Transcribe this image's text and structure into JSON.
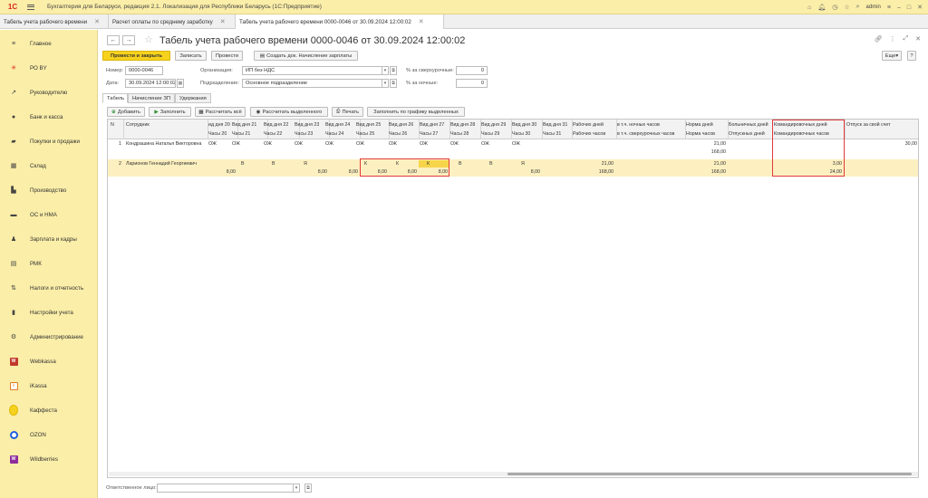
{
  "app": {
    "title": "Бухгалтерия для Беларуси, редакция 2.1. Локализация для Республики Беларусь  (1С:Предприятие)",
    "logo": "1С",
    "user": "admin",
    "colors": {
      "accent": "#f7d21d",
      "sidebar": "#fbeea8",
      "highlight": "#e03a3a"
    }
  },
  "tabs": [
    {
      "label": "Табель учета рабочего времени"
    },
    {
      "label": "Расчет оплаты по среднему заработку"
    },
    {
      "label": "Табель учета рабочего времени 0000-0046 от 30.09.2024 12:00:02"
    }
  ],
  "sidebar": {
    "items": [
      {
        "label": "Главное",
        "icon": "menu-icon"
      },
      {
        "label": "РО BY",
        "icon": "star-icon"
      },
      {
        "label": "Руководителю",
        "icon": "trend-icon"
      },
      {
        "label": "Банк и касса",
        "icon": "coin-icon"
      },
      {
        "label": "Покупки и продажи",
        "icon": "cart-icon"
      },
      {
        "label": "Склад",
        "icon": "warehouse-icon"
      },
      {
        "label": "Производство",
        "icon": "factory-icon"
      },
      {
        "label": "ОС и НМА",
        "icon": "truck-icon"
      },
      {
        "label": "Зарплата и кадры",
        "icon": "person-icon"
      },
      {
        "label": "РМК",
        "icon": "register-icon"
      },
      {
        "label": "Налоги и отчетность",
        "icon": "taxes-icon"
      },
      {
        "label": "Настройки учета",
        "icon": "book-icon"
      },
      {
        "label": "Администрирование",
        "icon": "gear-icon"
      },
      {
        "label": "Webkassa",
        "icon": "webkassa-icon"
      },
      {
        "label": "iKassa",
        "icon": "ikassa-icon"
      },
      {
        "label": "Каффеста",
        "icon": "kaffesta-icon"
      },
      {
        "label": "OZON",
        "icon": "ozon-icon"
      },
      {
        "label": "Wildberries",
        "icon": "wildberries-icon"
      }
    ]
  },
  "doc": {
    "title": "Табель учета рабочего времени 0000-0046 от 30.09.2024 12:00:02",
    "toolbar": {
      "post_close": "Провести и закрыть",
      "save": "Записать",
      "post": "Провести",
      "create_based": "Создать док. Начисление зарплаты",
      "more": "Еще",
      "help": "?"
    },
    "fields": {
      "number_label": "Номер:",
      "number": "0000-0046",
      "date_label": "Дата:",
      "date": "30.09.2024 12:00:02",
      "org_label": "Организация:",
      "org": "ИП без НДС",
      "dept_label": "Подразделение:",
      "dept": "Основное подразделение",
      "overtime_label": "% за сверхурочные:",
      "overtime": "0",
      "night_label": "% за ночные:",
      "night": "0"
    },
    "subtabs": [
      "Табель",
      "Начисление ЗП",
      "Удержания"
    ],
    "gridbar": {
      "add": "Добавить",
      "fill": "Заполнить",
      "calc_all": "Рассчитать всё",
      "calc_selected": "Рассчитать выделенного",
      "print": "Печать",
      "fill_schedule": "Заполнить по графику выделенных"
    },
    "table": {
      "headers": {
        "n": "N",
        "employee": "Сотрудник",
        "days": [
          {
            "top": "ид дня 20",
            "bottom": "Часы 20"
          },
          {
            "top": "Вид дня 21",
            "bottom": "Часы 21"
          },
          {
            "top": "Вид дня 22",
            "bottom": "Часы 22"
          },
          {
            "top": "Вид дня 23",
            "bottom": "Часы 23"
          },
          {
            "top": "Вид дня 24",
            "bottom": "Часы 24"
          },
          {
            "top": "Вид дня 25",
            "bottom": "Часы 25"
          },
          {
            "top": "Вид дня 26",
            "bottom": "Часы 26"
          },
          {
            "top": "Вид дня 27",
            "bottom": "Часы 27"
          },
          {
            "top": "Вид дня 28",
            "bottom": "Часы 28"
          },
          {
            "top": "Вид дня 29",
            "bottom": "Часы 29"
          },
          {
            "top": "Вид дня 30",
            "bottom": "Часы 30"
          },
          {
            "top": "Вид дня 31",
            "bottom": "Часы 31"
          }
        ],
        "work_days": "Рабочих дней",
        "work_hours": "Рабочих часов",
        "night": "в т.ч. ночных часов",
        "overtime": "в т.ч. сверхурочных часов",
        "norm_days": "Норма дней",
        "norm_hours": "Норма часов",
        "sick": "Больничных дней",
        "vacation": "Отпускных дней",
        "trip_days": "Командировочных дней",
        "trip_hours": "Командировочных часов",
        "leave": "Отпуск за свой счет"
      },
      "rows": [
        {
          "n": "1",
          "employee": "Кондрашина Наталья Викторовна",
          "days": [
            {
              "k": "ОЖ",
              "h": ""
            },
            {
              "k": "ОЖ",
              "h": ""
            },
            {
              "k": "ОЖ",
              "h": ""
            },
            {
              "k": "ОЖ",
              "h": ""
            },
            {
              "k": "ОЖ",
              "h": ""
            },
            {
              "k": "ОЖ",
              "h": ""
            },
            {
              "k": "ОЖ",
              "h": ""
            },
            {
              "k": "ОЖ",
              "h": ""
            },
            {
              "k": "ОЖ",
              "h": ""
            },
            {
              "k": "ОЖ",
              "h": ""
            },
            {
              "k": "ОЖ",
              "h": ""
            },
            {
              "k": "",
              "h": ""
            }
          ],
          "work_days": "",
          "work_hours": "",
          "norm_days": "21,00",
          "norm_hours": "168,00",
          "trip_days": "",
          "trip_hours": "",
          "leave": "30,00"
        },
        {
          "n": "2",
          "employee": "Ларионов Геннадий Георгиевич",
          "days": [
            {
              "k": "",
              "h": "8,00"
            },
            {
              "k": "В",
              "h": ""
            },
            {
              "k": "В",
              "h": ""
            },
            {
              "k": "Я",
              "h": "8,00"
            },
            {
              "k": "",
              "h": "8,00"
            },
            {
              "k": "К",
              "h": "8,00"
            },
            {
              "k": "К",
              "h": "8,00"
            },
            {
              "k": "К",
              "h": "8,00"
            },
            {
              "k": "В",
              "h": ""
            },
            {
              "k": "В",
              "h": ""
            },
            {
              "k": "Я",
              "h": "8,00"
            },
            {
              "k": "",
              "h": ""
            }
          ],
          "work_days": "21,00",
          "work_hours": "168,00",
          "norm_days": "21,00",
          "norm_hours": "168,00",
          "trip_days": "3,00",
          "trip_hours": "24,00",
          "leave": ""
        }
      ]
    },
    "footer": {
      "resp_label": "Ответственное лицо:",
      "resp": ""
    }
  }
}
